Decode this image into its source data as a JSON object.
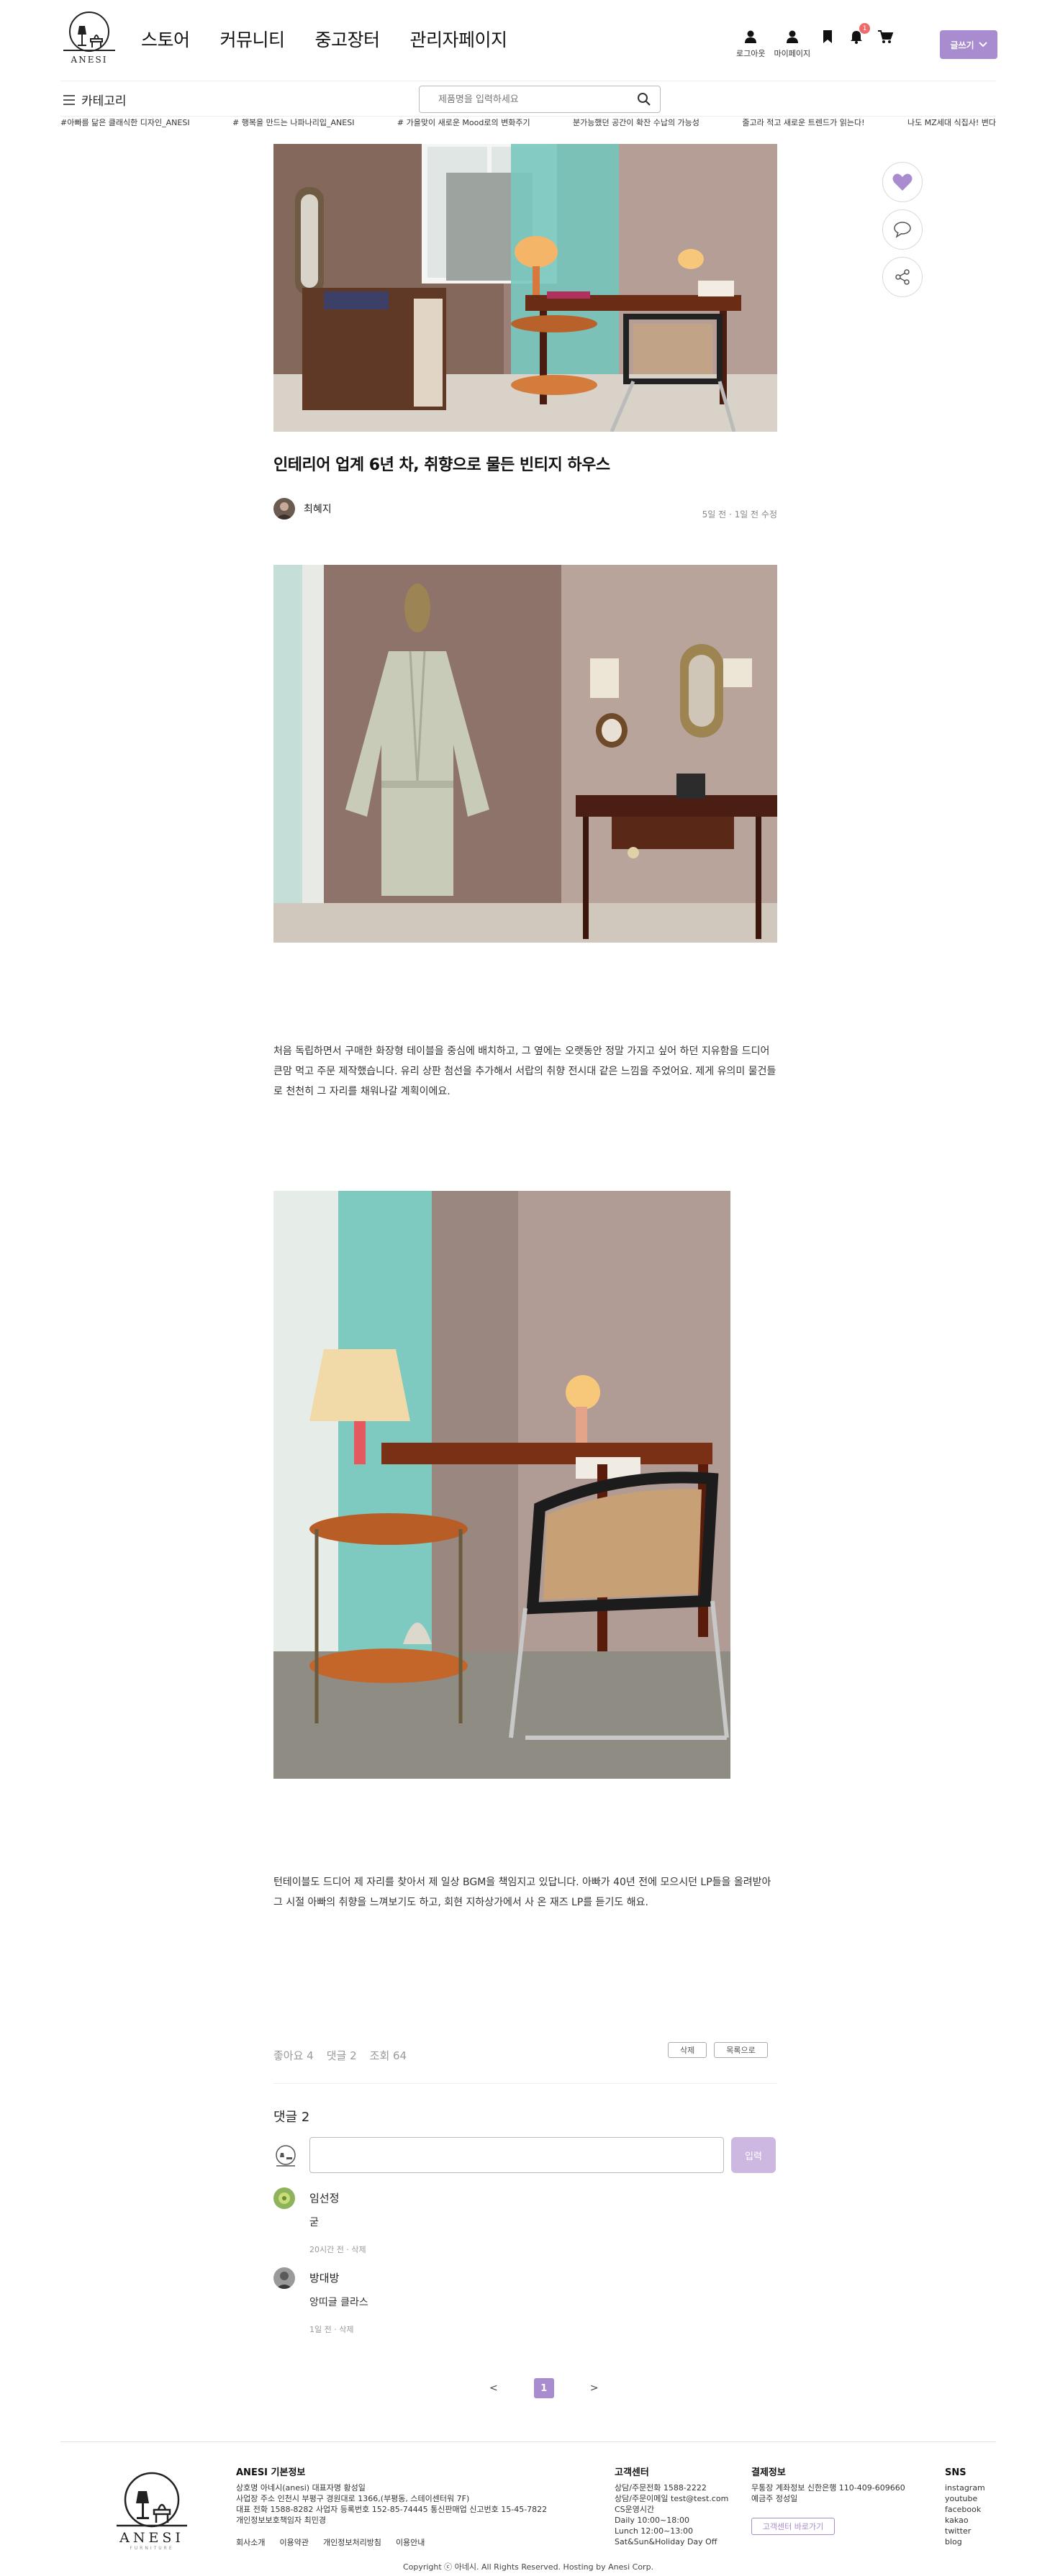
{
  "brand": {
    "name": "ANESI",
    "accent": "#a98bcf",
    "badge_color": "#f06a6a"
  },
  "nav": {
    "items": [
      "스토어",
      "커뮤니티",
      "중고장터",
      "관리자페이지"
    ]
  },
  "util": {
    "logout": "로그아웃",
    "mypage": "마이페이지",
    "notification_count": "1",
    "write_button": "글쓰기",
    "icons": [
      "person-icon",
      "person-icon",
      "bookmark-icon",
      "bell-icon",
      "cart-icon"
    ]
  },
  "subbar": {
    "category_label": "카테고리",
    "search_placeholder": "제품명을 입력하세요"
  },
  "ticker": [
    "#아빠를 닮은 클래식한 디자인_ANESI",
    "# 행복을 만드는 나파나리입_ANESI",
    "# 가을맞이 새로운 Mood로의 변화주기",
    "분가능했던 공간이 확잔 수납의 가능성",
    "줄고라 적고 새로운 트렌드가 읽는다!",
    "나도 MZ세대 식집사! 변다"
  ],
  "post": {
    "title": "인테리어 업계 6년 차, 취향으로 물든 빈티지 하우스",
    "author": "최혜지",
    "date": "5일 전 · 1일 전 수정",
    "paragraph1": "처음 독립하면서 구매한 화장형 테이블을 중심에 배치하고, 그 옆에는 오랫동안 정말 가지고 싶어 하던 지유함을 드디어 큰맘 먹고 주문 제작했습니다. 유리 상판 첨선을 추가해서 서랍의 취향 전시대 같은 느낌을 주었어요. 제게 유의미 물건들로 천천히 그 자리를 채워나갈 계획이에요.",
    "paragraph2": "턴테이블도 드디어 제 자리를 찾아서 제 일상 BGM을 책임지고 있답니다. 아빠가 40년 전에 모으시던 LP들을 올려받아 그 시절 아빠의 취향을 느껴보기도 하고, 회현 지하상가에서 사 온 재즈 LP를 듣기도 해요.",
    "likes": "좋아요 4",
    "comments_count": "댓글 2",
    "views": "조회 64",
    "delete_label": "삭제",
    "list_label": "목록으로"
  },
  "comments": {
    "title": "댓글 2",
    "submit_label": "입력",
    "items": [
      {
        "name": "임선정",
        "text": "굳",
        "meta": "20시간 전 · 삭제"
      },
      {
        "name": "방대방",
        "text": "앙띠글 클라스",
        "meta": "1일 전 · 삭제"
      }
    ]
  },
  "pagination": {
    "prev": "<",
    "current": "1",
    "next": ">"
  },
  "footer": {
    "logo_sub": "FURNITURE",
    "info_title": "ANESI 기본정보",
    "info_lines": [
      "상호명 아네시(anesi) 대표자명 황성일",
      "사업장 주소 인천시 부평구 경원대로 1366,(부평동, 스테이센터워 7F)",
      "대표 전화 1588-8282 사업자 등록번호 152-85-74445 통신판매업 신고번호 15-45-7822",
      "개인정보보호책임자 최민경"
    ],
    "links": [
      "회사소개",
      "이용약관",
      "개인정보처리방침",
      "이용안내"
    ],
    "cs_title": "고객센터",
    "cs_lines": [
      "상담/주문전화 1588-2222",
      "상담/주문이메일 test@test.com",
      "CS운영시간",
      "Daily 10:00~18:00",
      "Lunch 12:00~13:00",
      "Sat&Sun&Holiday Day Off"
    ],
    "pay_title": "결제정보",
    "pay_lines": [
      "무통장 계좌정보 신한은행 110-409-609660",
      "예금주 정성일"
    ],
    "cs_button": "고객센터 바로가기",
    "sns_title": "SNS",
    "sns_links": [
      "instagram",
      "youtube",
      "facebook",
      "kakao",
      "twitter",
      "blog"
    ],
    "copyright": "Copyright ⓒ 아네시. All Rights Reserved. Hosting by Anesi Corp."
  }
}
